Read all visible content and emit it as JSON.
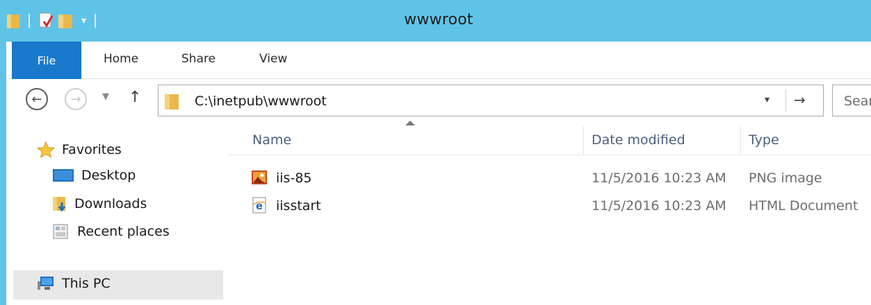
{
  "window": {
    "title": "wwwroot"
  },
  "quick_access": {
    "icons": [
      "folder-icon",
      "properties-icon",
      "new-folder-icon",
      "customize-dropdown-icon"
    ]
  },
  "ribbon": {
    "file_label": "File",
    "tabs": [
      "Home",
      "Share",
      "View"
    ]
  },
  "address_bar": {
    "path": "C:\\inetpub\\wwwroot",
    "search_placeholder": "Searc"
  },
  "nav_pane": {
    "favorites_label": "Favorites",
    "items": [
      {
        "label": "Desktop",
        "icon": "desktop-icon"
      },
      {
        "label": "Downloads",
        "icon": "downloads-folder-icon"
      },
      {
        "label": "Recent places",
        "icon": "recent-places-icon"
      }
    ],
    "this_pc_label": "This PC"
  },
  "file_list": {
    "columns": [
      "Name",
      "Date modified",
      "Type"
    ],
    "sort_column": "Name",
    "rows": [
      {
        "name": "iis-85",
        "date": "11/5/2016 10:23 AM",
        "type": "PNG image",
        "icon": "png-image-icon"
      },
      {
        "name": "iisstart",
        "date": "11/5/2016 10:23 AM",
        "type": "HTML Document",
        "icon": "html-document-icon"
      }
    ]
  },
  "colors": {
    "title_bar": "#5fc3e8",
    "file_tab": "#1979ca",
    "selected_nav": "#e8e8e8"
  }
}
